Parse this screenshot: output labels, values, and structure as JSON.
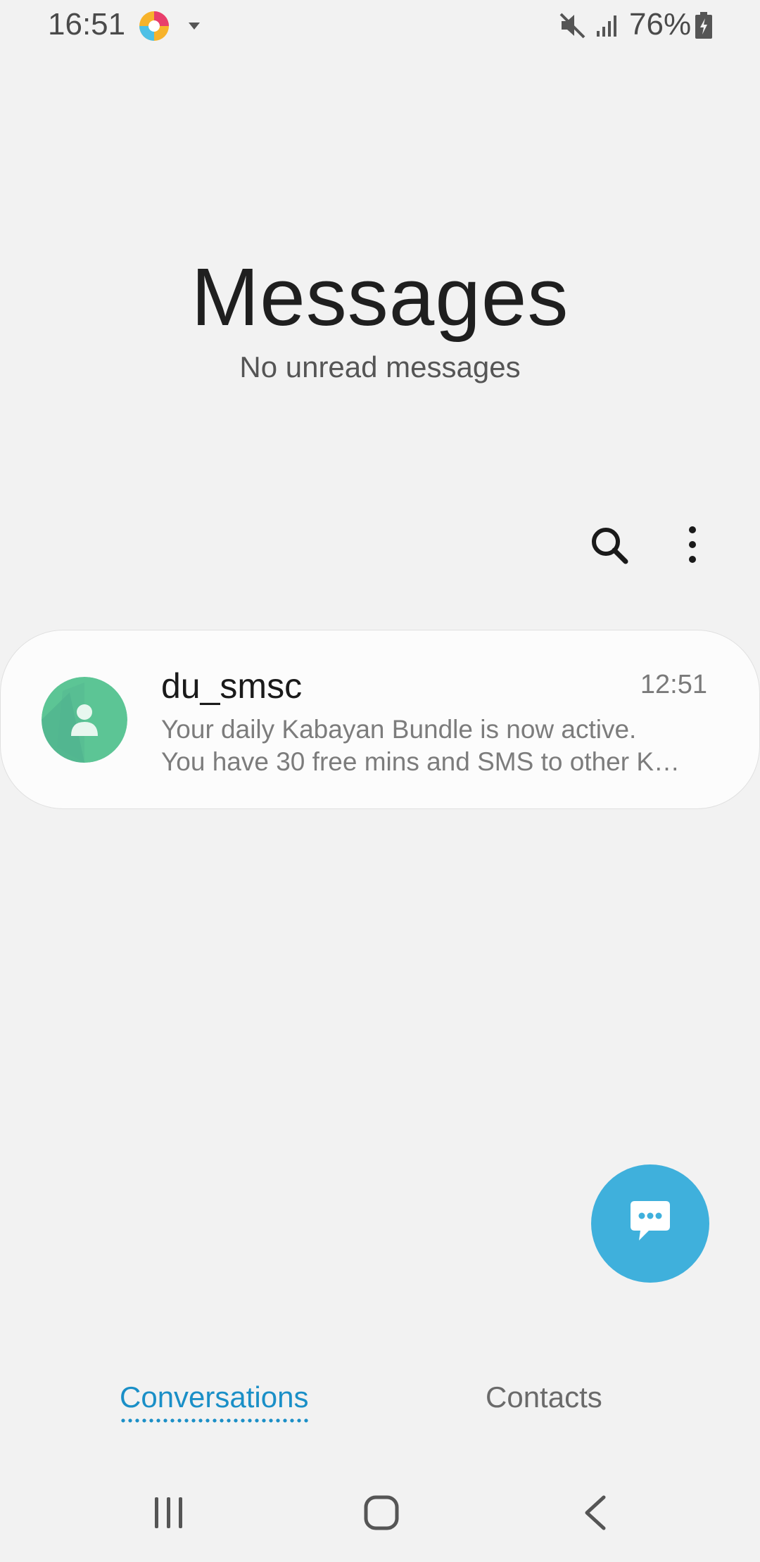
{
  "status_bar": {
    "time": "16:51",
    "battery_percent": "76%",
    "icons": [
      "app-notification-icon",
      "dropdown-caret-icon",
      "mute-icon",
      "signal-icon",
      "battery-charging-icon"
    ]
  },
  "header": {
    "title": "Messages",
    "subtitle": "No unread messages"
  },
  "toolbar": {
    "icons": [
      "search-icon",
      "more-options-icon"
    ]
  },
  "conversations": [
    {
      "name": "du_smsc",
      "time": "12:51",
      "preview_line1": "Your daily Kabayan Bundle is now active.",
      "preview_line2": "You have 30 free mins and SMS to other K…",
      "avatar_icon": "person-icon"
    }
  ],
  "fab": {
    "icon": "compose-message-icon"
  },
  "tabs": [
    {
      "label": "Conversations",
      "selected": true
    },
    {
      "label": "Contacts",
      "selected": false
    }
  ],
  "nav_bar": {
    "icons": [
      "recent-apps-icon",
      "home-icon",
      "back-icon"
    ]
  },
  "colors": {
    "background": "#f2f2f2",
    "accent": "#1a8fc7",
    "fab": "#3fb0dc",
    "avatar": "#5cc595"
  }
}
